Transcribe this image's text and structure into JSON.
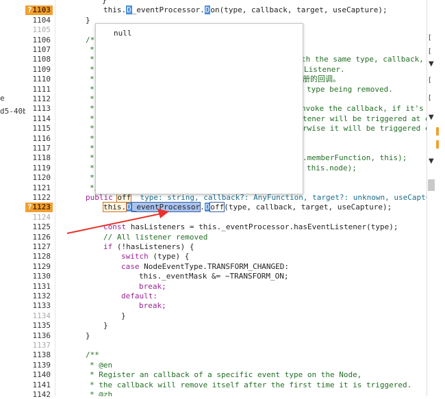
{
  "left_panel": {
    "frag1": "e",
    "frag2": "d5-40b"
  },
  "hover": {
    "value": "null"
  },
  "breakpoints": {
    "b1103": "1103",
    "b1123": "1123"
  },
  "lines": {
    "l1104": "1104",
    "l1105": "1105",
    "l1106": "1106",
    "l1107": "1107",
    "l1108": "1108",
    "l1109": "1109",
    "l1110": "1110",
    "l1111": "1111",
    "l1112": "1112",
    "l1113": "1113",
    "l1114": "1114",
    "l1115": "1115",
    "l1116": "1116",
    "l1117": "1117",
    "l1118": "1118",
    "l1119": "1119",
    "l1120": "1120",
    "l1121": "1121",
    "l1122": "1122",
    "l1124": "1124",
    "l1125": "1125",
    "l1126": "1126",
    "l1127": "1127",
    "l1128": "1128",
    "l1129": "1129",
    "l1130": "1130",
    "l1131": "1131",
    "l1132": "1132",
    "l1133": "1133",
    "l1134": "1134",
    "l1135": "1135",
    "l1136": "1136",
    "l1137": "1137",
    "l1138": "1138",
    "l1139": "1139",
    "l1140": "1140",
    "l1141": "1141",
    "l1142": "1142"
  },
  "code": {
    "c1102": "}",
    "c1103a": "this.",
    "c1103b": "_eventProcessor.",
    "c1103c": "on(type, callback, target, useCapture);",
    "c1104": "}",
    "c1106": "/**",
    "c1107": "*",
    "c1108": "th the same type, callback,",
    "c1109": "Listener.",
    "c1110": "册的回调。",
    "c1111": "type being removed.",
    "c1113": "nvoke the callback, if it's",
    "c1114": "tener will be triggered at c",
    "c1115": "rwise it will be triggered c",
    "c1118": ".memberFunction, this);",
    "c1119": "this.node);",
    "c1121": "*/",
    "c1122a": "public",
    "c1122b": "off",
    "c1122c": "type: string, callback?: AnyFunction, target?: unknown, useCaptu",
    "c1123a": "this.",
    "c1123b": "_eventProcessor",
    "c1123c": ".",
    "c1123d": "off",
    "c1123e": "(type, callback, target, useCapture);",
    "c1125a": "const",
    "c1125b": "hasListeners = this._eventProcessor.hasEventListener(type);",
    "c1126": "// All listener removed",
    "c1127a": "if",
    "c1127b": "(!hasListeners) {",
    "c1128a": "switch",
    "c1128b": "(type) {",
    "c1129a": "case",
    "c1129b": "NodeEventType.TRANSFORM_CHANGED:",
    "c1130": "this._eventMask &= ~TRANSFORM_ON;",
    "c1131": "break;",
    "c1132": "default:",
    "c1133": "break;",
    "c1134": "}",
    "c1135": "}",
    "c1136": "}",
    "c1138": "/**",
    "c1139": "* @en",
    "c1140": "* Register an callback of a specific event type on the Node,",
    "c1141": "* the callback will remove itself after the first time it is triggered.",
    "c1142": "* @zh"
  }
}
